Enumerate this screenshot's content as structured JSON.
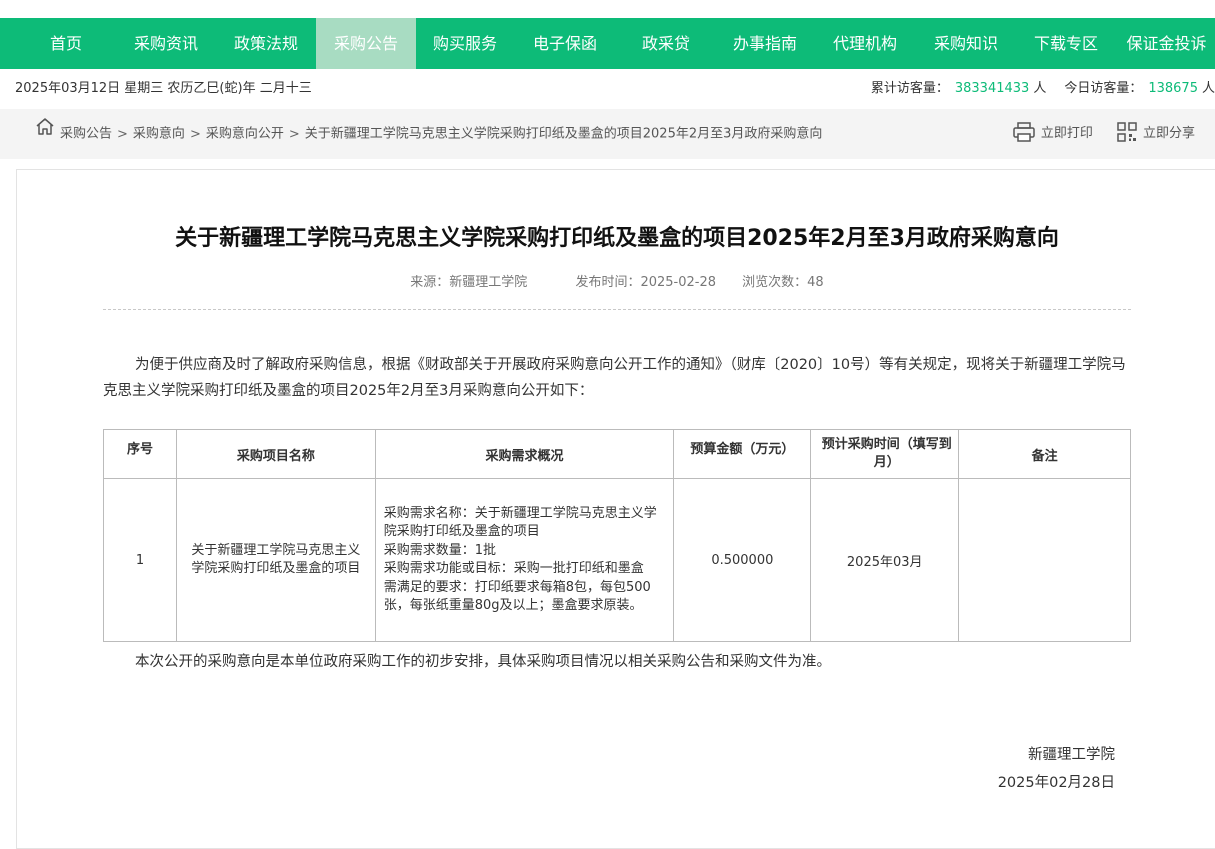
{
  "nav": {
    "items": [
      "首页",
      "采购资讯",
      "政策法规",
      "采购公告",
      "购买服务",
      "电子保函",
      "政采贷",
      "办事指南",
      "代理机构",
      "采购知识",
      "下载专区",
      "保证金投诉"
    ],
    "active_index": 3
  },
  "info": {
    "date": "2025年03月12日 星期三 农历乙巳(蛇)年 二月十三",
    "total_label": "累计访客量：",
    "total_value": "383341433",
    "total_unit": "人",
    "today_label": "今日访客量：",
    "today_value": "138675",
    "today_unit": "人"
  },
  "breadcrumb": {
    "items": [
      "采购公告",
      "采购意向",
      "采购意向公开"
    ],
    "separator": ">",
    "current": "关于新疆理工学院马克思主义学院采购打印纸及墨盒的项目2025年2月至3月政府采购意向"
  },
  "tools": {
    "print": "立即打印",
    "share": "立即分享"
  },
  "article": {
    "title": "关于新疆理工学院马克思主义学院采购打印纸及墨盒的项目2025年2月至3月政府采购意向",
    "source": "来源：新疆理工学院",
    "publish": "发布时间：2025-02-28",
    "views": "浏览次数：48",
    "intro": "为便于供应商及时了解政府采购信息，根据《财政部关于开展政府采购意向公开工作的通知》（财库〔2020〕10号）等有关规定，现将关于新疆理工学院马克思主义学院采购打印纸及墨盒的项目2025年2月至3月采购意向公开如下：",
    "closing": "本次公开的采购意向是本单位政府采购工作的初步安排，具体采购项目情况以相关采购公告和采购文件为准。",
    "signer": "新疆理工学院",
    "sign_date": "2025年02月28日"
  },
  "table": {
    "headers": [
      "序号",
      "采购项目名称",
      "采购需求概况",
      "预算金额（万元）",
      "预计采购时间（填写到月）",
      "备注"
    ],
    "row": {
      "index": "1",
      "name": "关于新疆理工学院马克思主义学院采购打印纸及墨盒的项目",
      "desc_lines": [
        "采购需求名称：关于新疆理工学院马克思主义学院采购打印纸及墨盒的项目",
        "采购需求数量：1批",
        "采购需求功能或目标：采购一批打印纸和墨盒",
        "需满足的要求：打印纸要求每箱8包，每包500张，每张纸重量80g及以上；墨盒要求原装。"
      ],
      "budget": "0.500000",
      "time": "2025年03月",
      "note": ""
    }
  },
  "colors": {
    "nav_bg": "#0dbb78",
    "nav_active": "#a8dcc2",
    "accent": "#0dbb78"
  }
}
